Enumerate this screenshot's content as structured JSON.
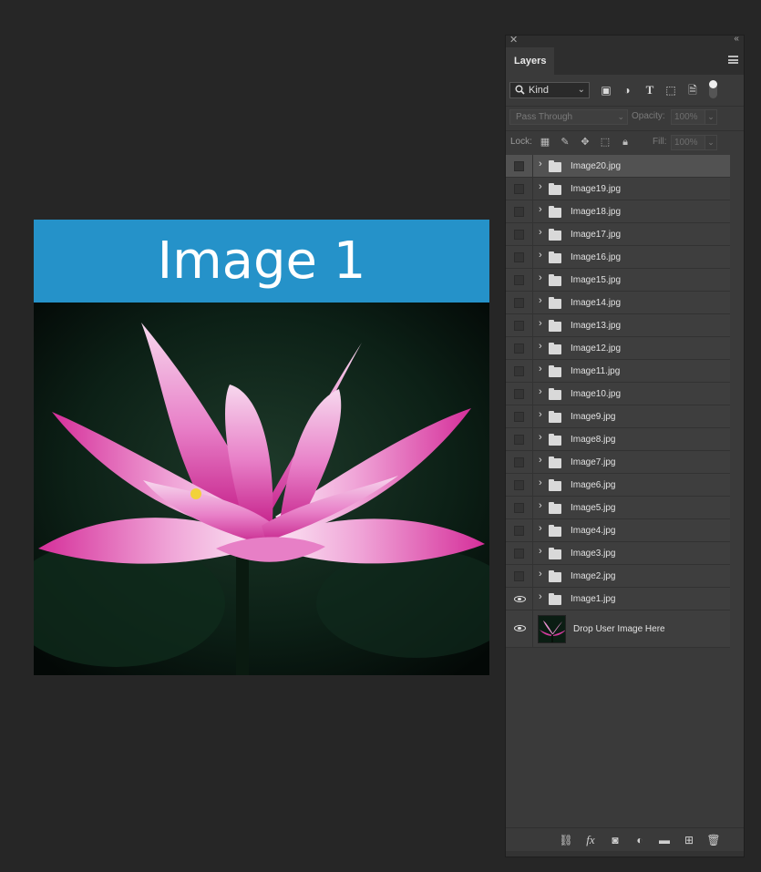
{
  "document": {
    "banner_text": "Image 1"
  },
  "panel": {
    "tab_label": "Layers",
    "filter_kind": "Kind",
    "blend_mode": "Pass Through",
    "opacity_label": "Opacity:",
    "opacity_value": "100%",
    "lock_label": "Lock:",
    "fill_label": "Fill:",
    "fill_value": "100%",
    "layers": [
      {
        "name": "Image20.jpg",
        "visible": false,
        "selected": true
      },
      {
        "name": "Image19.jpg",
        "visible": false
      },
      {
        "name": "Image18.jpg",
        "visible": false
      },
      {
        "name": "Image17.jpg",
        "visible": false
      },
      {
        "name": "Image16.jpg",
        "visible": false
      },
      {
        "name": "Image15.jpg",
        "visible": false
      },
      {
        "name": "Image14.jpg",
        "visible": false
      },
      {
        "name": "Image13.jpg",
        "visible": false
      },
      {
        "name": "Image12.jpg",
        "visible": false
      },
      {
        "name": "Image11.jpg",
        "visible": false
      },
      {
        "name": "Image10.jpg",
        "visible": false
      },
      {
        "name": "Image9.jpg",
        "visible": false
      },
      {
        "name": "Image8.jpg",
        "visible": false
      },
      {
        "name": "Image7.jpg",
        "visible": false
      },
      {
        "name": "Image6.jpg",
        "visible": false
      },
      {
        "name": "Image5.jpg",
        "visible": false
      },
      {
        "name": "Image4.jpg",
        "visible": false
      },
      {
        "name": "Image3.jpg",
        "visible": false
      },
      {
        "name": "Image2.jpg",
        "visible": false
      },
      {
        "name": "Image1.jpg",
        "visible": true
      }
    ],
    "base_layer": {
      "name": "Drop User Image Here",
      "visible": true
    },
    "bottom_icons": [
      "link-icon",
      "fx-icon",
      "mask-icon",
      "adjustment-icon",
      "new-group-icon",
      "new-layer-icon",
      "trash-icon"
    ],
    "fx_text": "fx"
  }
}
